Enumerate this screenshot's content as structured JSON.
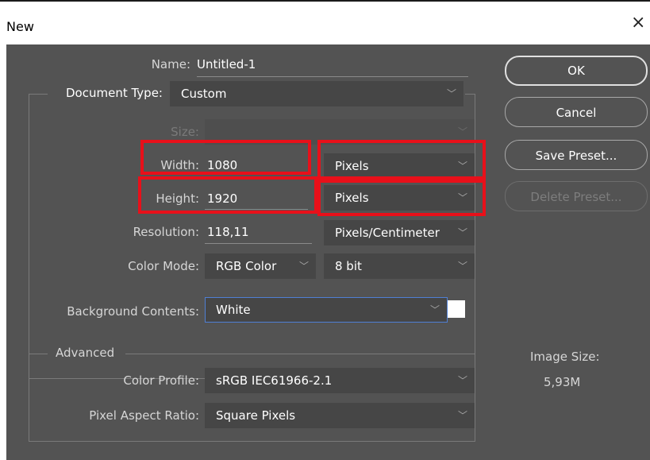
{
  "window": {
    "title": "New",
    "close_glyph": "×"
  },
  "form": {
    "name": {
      "label": "Name:",
      "value": "Untitled-1"
    },
    "document_type": {
      "label": "Document Type:",
      "value": "Custom"
    },
    "size": {
      "label": "Size:",
      "value": ""
    },
    "width": {
      "label": "Width:",
      "value": "1080",
      "unit": "Pixels"
    },
    "height": {
      "label": "Height:",
      "value": "1920",
      "unit": "Pixels"
    },
    "resolution": {
      "label": "Resolution:",
      "value": "118,11",
      "unit": "Pixels/Centimeter"
    },
    "color_mode": {
      "label": "Color Mode:",
      "value": "RGB Color",
      "depth": "8 bit"
    },
    "background": {
      "label": "Background Contents:",
      "value": "White",
      "swatch_color": "#ffffff"
    },
    "advanced": {
      "title": "Advanced",
      "color_profile": {
        "label": "Color Profile:",
        "value": "sRGB IEC61966-2.1"
      },
      "pixel_aspect": {
        "label": "Pixel Aspect Ratio:",
        "value": "Square Pixels"
      }
    }
  },
  "buttons": {
    "ok": "OK",
    "cancel": "Cancel",
    "save_preset": "Save Preset...",
    "delete_preset": "Delete Preset..."
  },
  "image_size": {
    "label": "Image Size:",
    "value": "5,93M"
  },
  "icons": {
    "chevron": "chevron-down-icon",
    "close": "close-icon"
  },
  "colors": {
    "dialog_bg": "#535353",
    "highlight": "#e8101a",
    "focus": "#4f7fd4"
  }
}
